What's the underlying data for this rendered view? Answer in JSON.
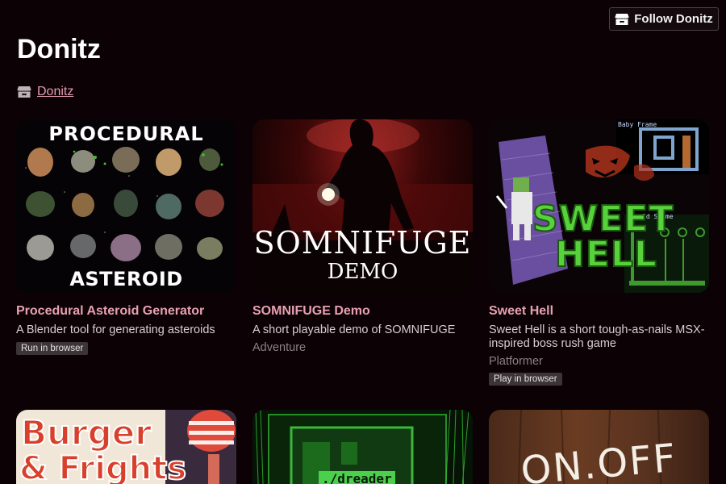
{
  "header": {
    "follow_label": "Follow Donitz",
    "title": "Donitz",
    "author_link": "Donitz"
  },
  "games": [
    {
      "title": "Procedural Asteroid Generator",
      "description": "A Blender tool for generating asteroids",
      "genre": "",
      "badge": "Run in browser",
      "thumb_top": "PROCEDURAL",
      "thumb_bottom": "ASTEROID GENERATOR"
    },
    {
      "title": "SOMNIFUGE Demo",
      "description": "A short playable demo of SOMNIFUGE",
      "genre": "Adventure",
      "badge": "",
      "thumb_top": "SOMNIFUGE",
      "thumb_bottom": "DEMO"
    },
    {
      "title": "Sweet Hell",
      "description": "Sweet Hell is a short tough-as-nails MSX-inspired boss rush game",
      "genre": "Platformer",
      "badge": "Play in browser",
      "thumb_top": "SWEET",
      "thumb_bottom": "HELL",
      "thumb_hud": "Baby Frame",
      "thumb_hud2": "Id Slime"
    },
    {
      "thumb_top": "Burger",
      "thumb_bottom": "& Frights"
    },
    {
      "thumb_top": "./dreader"
    },
    {
      "thumb_top": "ON.OFF"
    }
  ]
}
